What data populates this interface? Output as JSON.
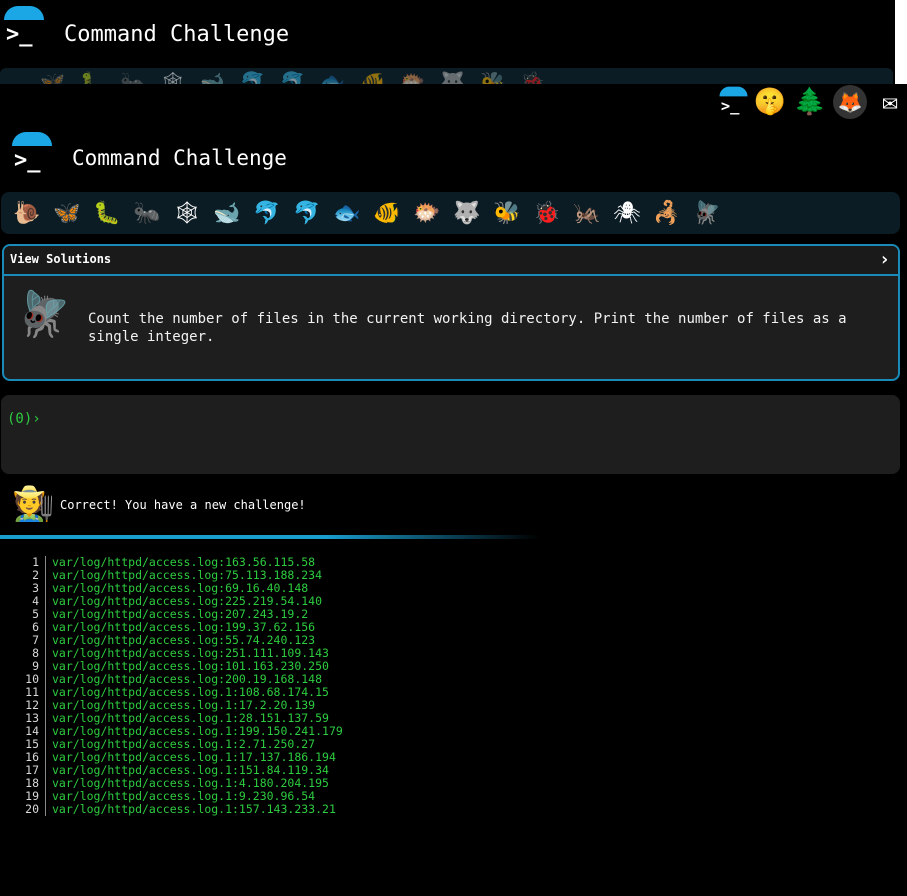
{
  "app": {
    "title": "Command Challenge"
  },
  "ghost": {
    "title": "Command Challenge"
  },
  "top_icons": [
    "terminal-logo",
    "shushing-face",
    "christmas-tree",
    "gitlab",
    "envelope"
  ],
  "strip_icons": [
    "🐌",
    "🦋",
    "🐛",
    "🐜",
    "🕸",
    "🐋",
    "🐬",
    "🐬",
    "🐟",
    "🐠",
    "🐡",
    "🐺",
    "🐝",
    "🐞",
    "🦗",
    "🕷",
    "🦂",
    "🪰"
  ],
  "challenge": {
    "view_solutions": "View Solutions",
    "chevron": "›",
    "description": "Count the number of files in the current working directory. Print the number of files as a single integer."
  },
  "terminal": {
    "prompt": "(0)›"
  },
  "notice": {
    "message": "Correct! You have a new challenge!"
  },
  "output": [
    {
      "n": "1",
      "text": "var/log/httpd/access.log:163.56.115.58"
    },
    {
      "n": "2",
      "text": "var/log/httpd/access.log:75.113.188.234"
    },
    {
      "n": "3",
      "text": "var/log/httpd/access.log:69.16.40.148"
    },
    {
      "n": "4",
      "text": "var/log/httpd/access.log:225.219.54.140"
    },
    {
      "n": "5",
      "text": "var/log/httpd/access.log:207.243.19.2"
    },
    {
      "n": "6",
      "text": "var/log/httpd/access.log:199.37.62.156"
    },
    {
      "n": "7",
      "text": "var/log/httpd/access.log:55.74.240.123"
    },
    {
      "n": "8",
      "text": "var/log/httpd/access.log:251.111.109.143"
    },
    {
      "n": "9",
      "text": "var/log/httpd/access.log:101.163.230.250"
    },
    {
      "n": "10",
      "text": "var/log/httpd/access.log:200.19.168.148"
    },
    {
      "n": "11",
      "text": "var/log/httpd/access.log.1:108.68.174.15"
    },
    {
      "n": "12",
      "text": "var/log/httpd/access.log.1:17.2.20.139"
    },
    {
      "n": "13",
      "text": "var/log/httpd/access.log.1:28.151.137.59"
    },
    {
      "n": "14",
      "text": "var/log/httpd/access.log.1:199.150.241.179"
    },
    {
      "n": "15",
      "text": "var/log/httpd/access.log.1:2.71.250.27"
    },
    {
      "n": "16",
      "text": "var/log/httpd/access.log.1:17.137.186.194"
    },
    {
      "n": "17",
      "text": "var/log/httpd/access.log.1:151.84.119.34"
    },
    {
      "n": "18",
      "text": "var/log/httpd/access.log.1:4.180.204.195"
    },
    {
      "n": "19",
      "text": "var/log/httpd/access.log.1:9.230.96.54"
    },
    {
      "n": "20",
      "text": "var/log/httpd/access.log.1:157.143.233.21"
    }
  ]
}
